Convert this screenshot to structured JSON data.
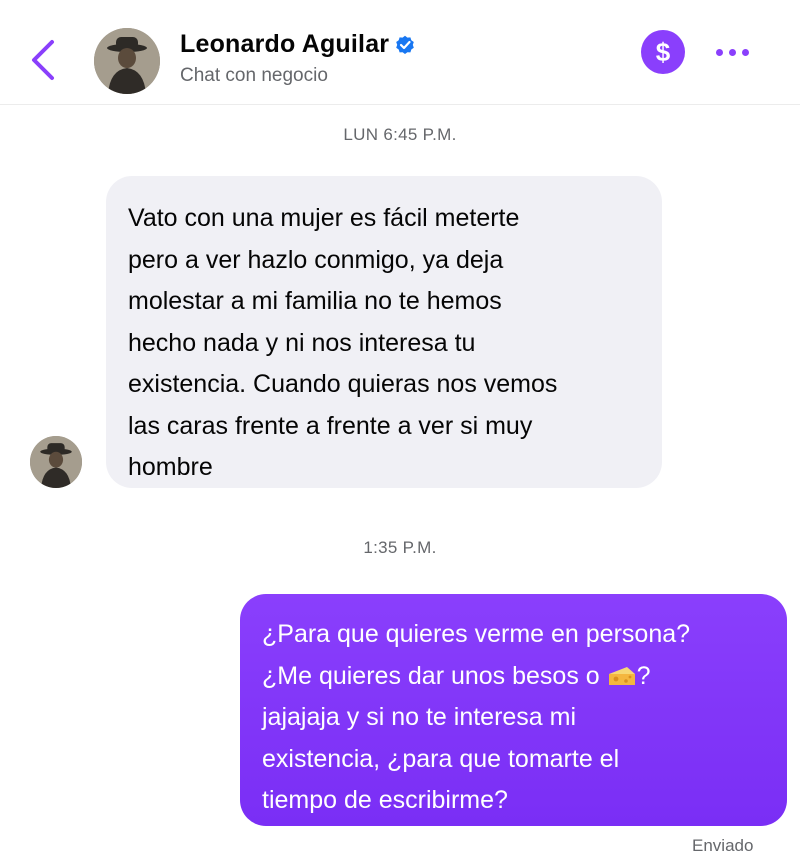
{
  "header": {
    "contact_name": "Leonardo Aguilar",
    "subtitle": "Chat con negocio",
    "back_icon": "chevron-left-icon",
    "verified_icon": "verified-badge-icon",
    "payment_icon": "dollar-icon",
    "payment_symbol": "$",
    "more_icon": "more-dots-icon"
  },
  "colors": {
    "accent": "#8a3ffc",
    "incoming_bubble": "#f0f0f5",
    "verified": "#1877f2",
    "muted_text": "#65676b"
  },
  "conversation": {
    "timestamp_1": "LUN 6:45 P.M.",
    "incoming_message": "Vato con una mujer es fácil meterte\npero a ver hazlo conmigo, ya deja\nmolestar a mi familia no te hemos\nhecho nada y ni nos interesa tu\nexistencia. Cuando quieras nos vemos\nlas caras frente a frente a ver si muy\nhombre",
    "timestamp_2": "1:35 P.M.",
    "outgoing_message": {
      "line1": "¿Para que quieres verme en persona?",
      "line2_before_emoji": "¿Me quieres dar unos besos o ",
      "emoji": "cheese-icon",
      "line2_after_emoji": "?",
      "line3": "jajajaja y si no te interesa mi",
      "line4": "existencia, ¿para que tomarte el",
      "line5": "tiempo de escribirme?"
    },
    "status": "Enviado"
  }
}
